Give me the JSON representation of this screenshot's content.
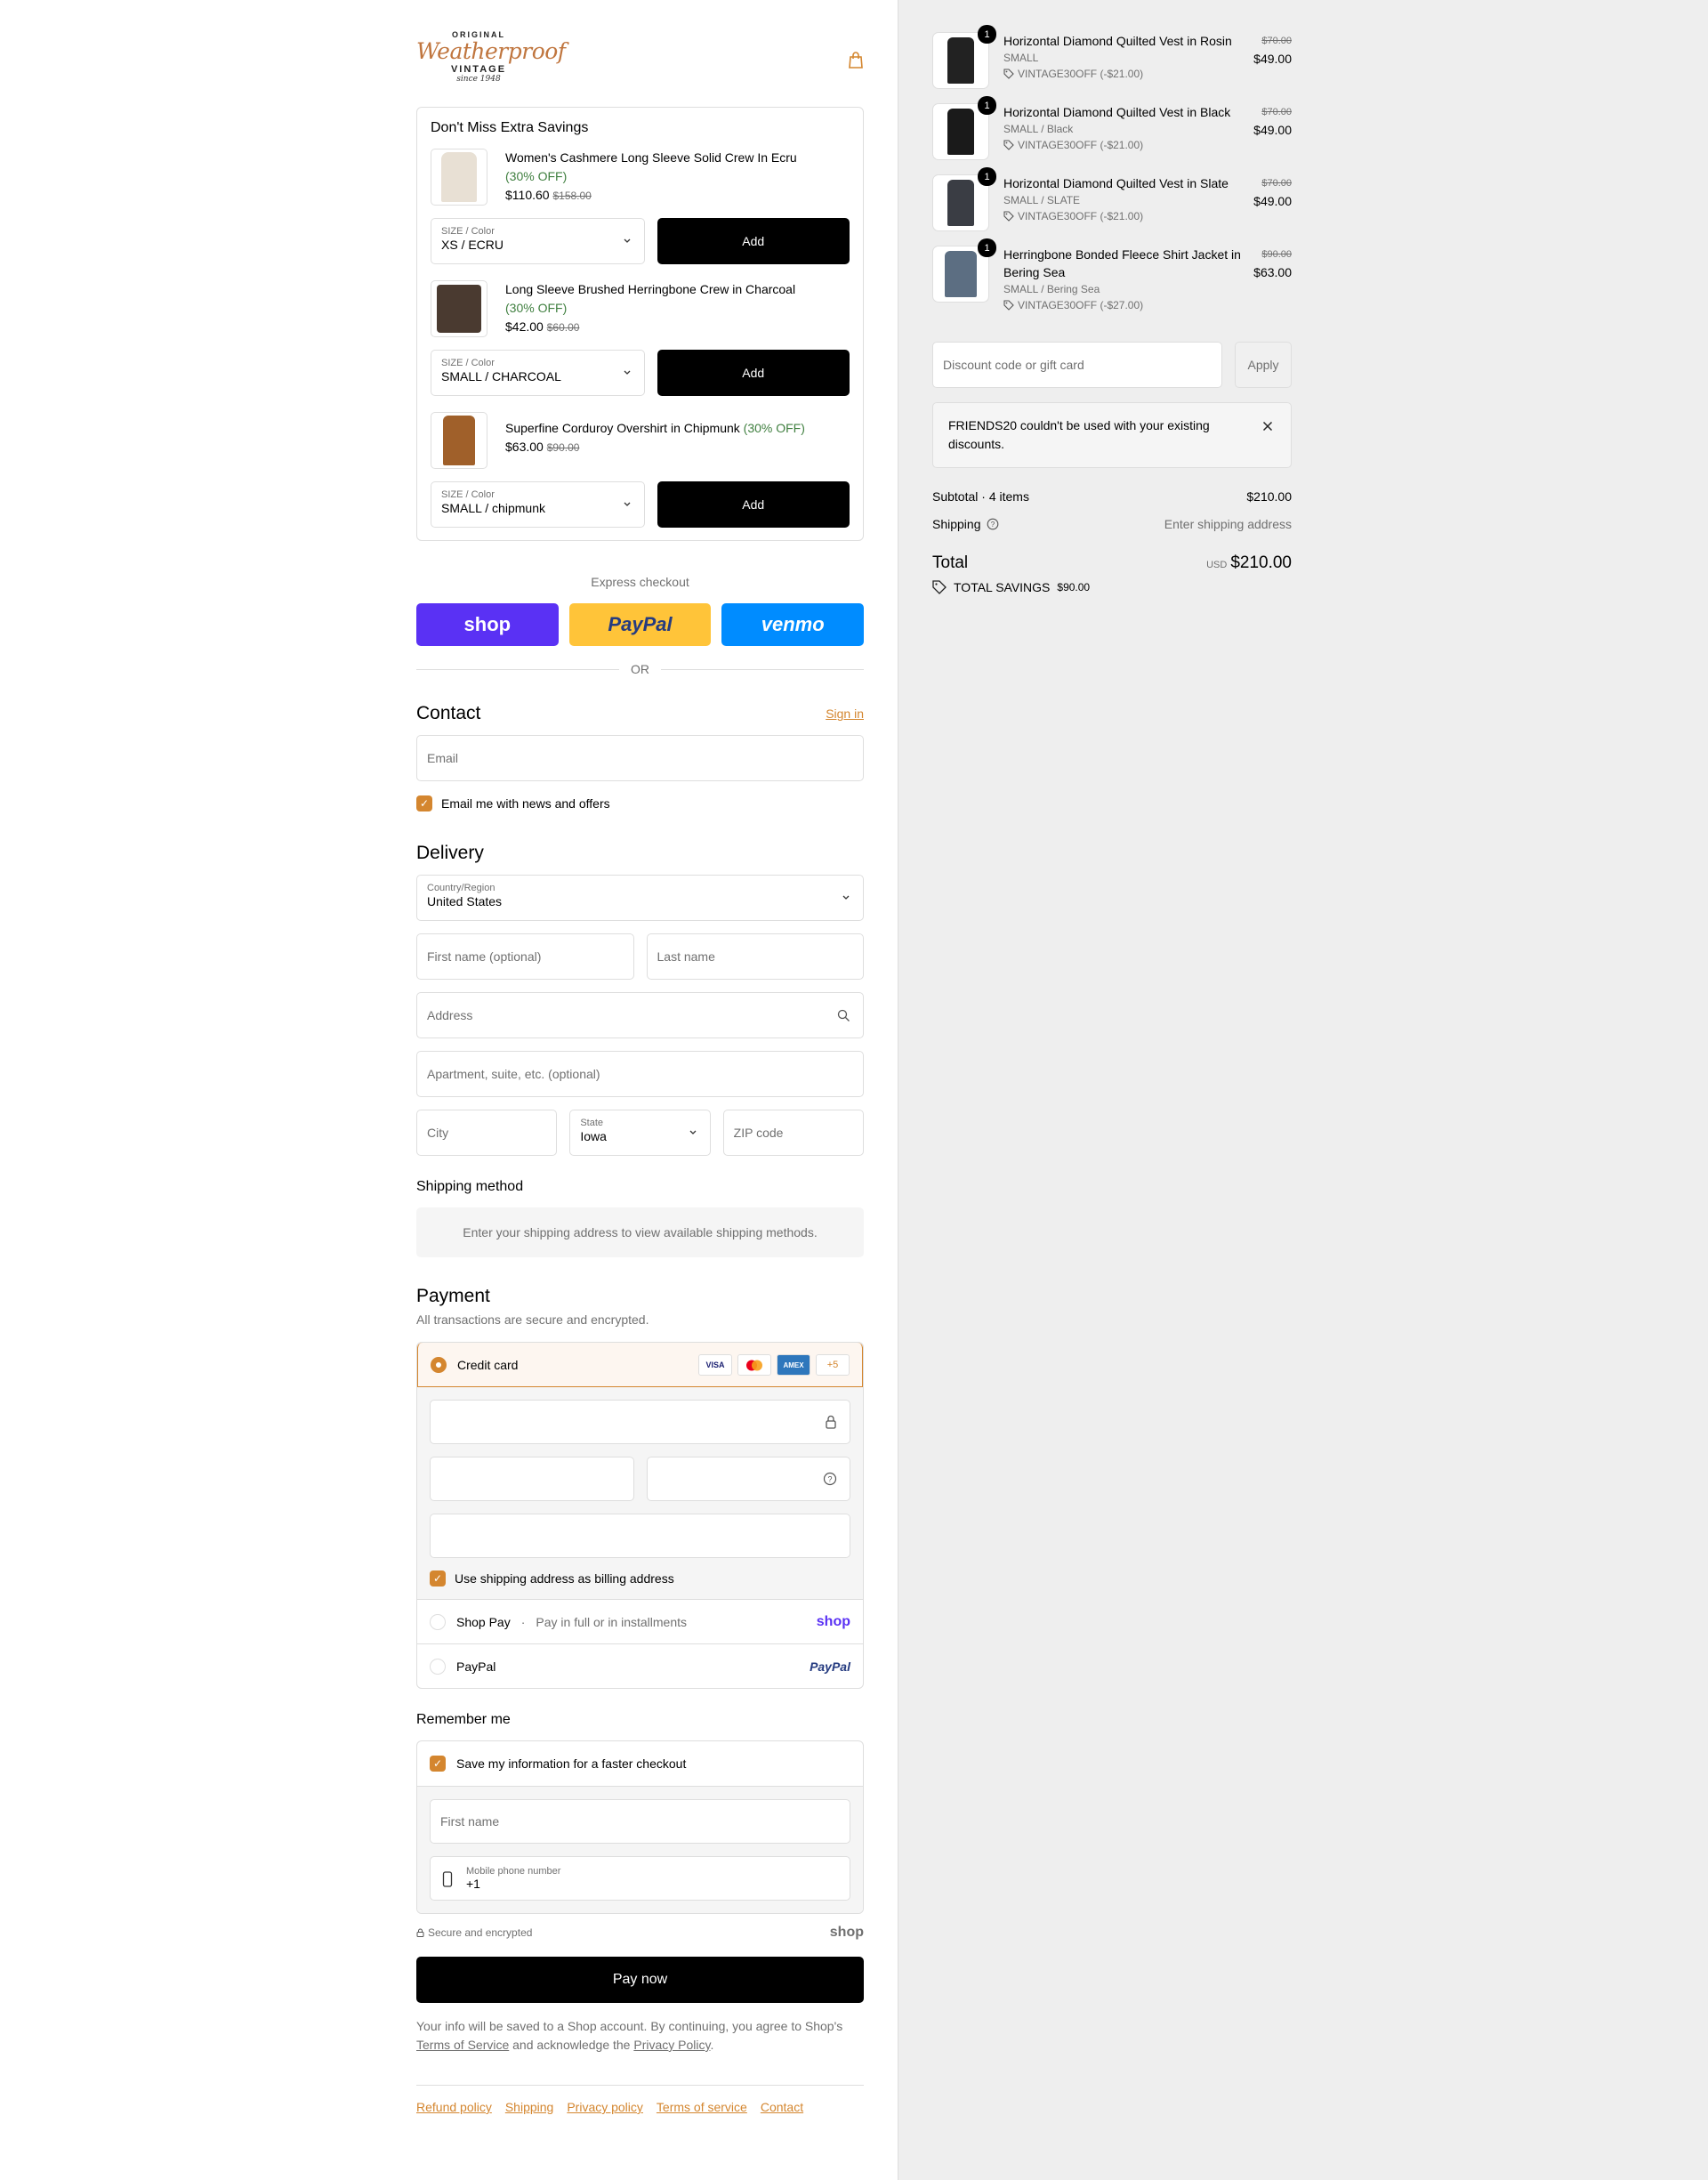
{
  "brand": {
    "top": "ORIGINAL",
    "script": "Weatherproof",
    "bottom": "VINTAGE",
    "since": "since 1948"
  },
  "upsell": {
    "title": "Don't Miss Extra Savings",
    "items": [
      {
        "name": "Women's Cashmere Long Sleeve Solid Crew In Ecru",
        "off": "(30% OFF)",
        "price": "$110.60",
        "compare": "$158.00",
        "select_label": "SIZE / Color",
        "select_value": "XS / ECRU",
        "button": "Add",
        "thumb_color": "#e8e0d4"
      },
      {
        "name": "Long Sleeve Brushed Herringbone Crew in Charcoal",
        "off": "(30% OFF)",
        "price": "$42.00",
        "compare": "$60.00",
        "select_label": "SIZE / Color",
        "select_value": "SMALL / CHARCOAL",
        "button": "Add",
        "thumb_color": "#4a3a30"
      },
      {
        "name": "Superfine Corduroy Overshirt in Chipmunk",
        "off": "(30% OFF)",
        "price": "$63.00",
        "compare": "$90.00",
        "select_label": "SIZE / Color",
        "select_value": "SMALL / chipmunk",
        "button": "Add",
        "thumb_color": "#a0602a"
      }
    ]
  },
  "express": {
    "label": "Express checkout",
    "shop": "shop",
    "paypal": "PayPal",
    "venmo": "venmo",
    "or": "OR"
  },
  "contact": {
    "heading": "Contact",
    "sign_in": "Sign in",
    "email_placeholder": "Email",
    "news": "Email me with news and offers"
  },
  "delivery": {
    "heading": "Delivery",
    "country_label": "Country/Region",
    "country": "United States",
    "first_name": "First name (optional)",
    "last_name": "Last name",
    "address": "Address",
    "apartment": "Apartment, suite, etc. (optional)",
    "city": "City",
    "state_label": "State",
    "state": "Iowa",
    "zip": "ZIP code",
    "shipping_method": "Shipping method",
    "shipping_note": "Enter your shipping address to view available shipping methods."
  },
  "payment": {
    "heading": "Payment",
    "subtitle": "All transactions are secure and encrypted.",
    "credit_card": "Credit card",
    "cards": [
      "VISA",
      "MC",
      "AMEX"
    ],
    "more_cards": "+5",
    "billing": "Use shipping address as billing address",
    "shop_pay": "Shop Pay",
    "shop_pay_desc": "Pay in full or in installments",
    "shop_logo": "shop",
    "paypal": "PayPal",
    "paypal_logo": "PayPal"
  },
  "remember": {
    "heading": "Remember me",
    "save": "Save my information for a faster checkout",
    "first_name": "First name",
    "phone_label": "Mobile phone number",
    "phone_value": "+1",
    "secure": "Secure and encrypted",
    "shop_logo": "shop"
  },
  "pay_now": "Pay now",
  "legal": {
    "text1": "Your info will be saved to a Shop account. By continuing, you agree to Shop's",
    "tos": "Terms of Service",
    "and": " and acknowledge the ",
    "privacy": "Privacy Policy",
    "end": "."
  },
  "footer": [
    "Refund policy",
    "Shipping",
    "Privacy policy",
    "Terms of service",
    "Contact"
  ],
  "order": {
    "items": [
      {
        "qty": "1",
        "name": "Horizontal Diamond Quilted Vest in Rosin",
        "variant": "SMALL",
        "discount": "VINTAGE30OFF (-$21.00)",
        "compare": "$70.00",
        "price": "$49.00",
        "color": "#222"
      },
      {
        "qty": "1",
        "name": "Horizontal Diamond Quilted Vest in Black",
        "variant": "SMALL / Black",
        "discount": "VINTAGE30OFF (-$21.00)",
        "compare": "$70.00",
        "price": "$49.00",
        "color": "#1a1a1a"
      },
      {
        "qty": "1",
        "name": "Horizontal Diamond Quilted Vest in Slate",
        "variant": "SMALL / SLATE",
        "discount": "VINTAGE30OFF (-$21.00)",
        "compare": "$70.00",
        "price": "$49.00",
        "color": "#3a3d44"
      },
      {
        "qty": "1",
        "name": "Herringbone Bonded Fleece Shirt Jacket in Bering Sea",
        "variant": "SMALL / Bering Sea",
        "discount": "VINTAGE30OFF (-$27.00)",
        "compare": "$90.00",
        "price": "$63.00",
        "color": "#5c6e82"
      }
    ],
    "discount_placeholder": "Discount code or gift card",
    "apply": "Apply",
    "alert": "FRIENDS20 couldn't be used with your existing discounts.",
    "subtotal_label": "Subtotal · 4 items",
    "subtotal": "$210.00",
    "shipping_label": "Shipping",
    "shipping_value": "Enter shipping address",
    "total_label": "Total",
    "currency": "USD",
    "total": "$210.00",
    "savings_label": "TOTAL SAVINGS",
    "savings": "$90.00"
  },
  "colors": {
    "accent": "#d4862f",
    "shop": "#5a31f4",
    "paypal": "#ffc439",
    "venmo": "#008cff"
  }
}
